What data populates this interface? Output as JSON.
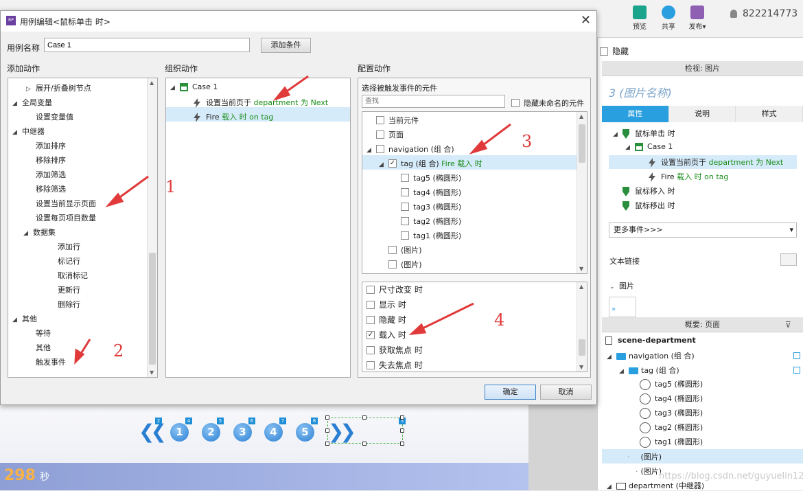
{
  "toolbar": {
    "preview": "预览",
    "share": "共享",
    "publish": "发布▾",
    "user_id": "822214773",
    "colors": {
      "preview": "#1aa48c",
      "share": "#2a9fdf",
      "publish": "#8e5fb3"
    }
  },
  "canvas": {
    "timer": "298",
    "timer_unit": "秒",
    "page_buttons": [
      "1",
      "2",
      "3",
      "4",
      "5"
    ],
    "badges": [
      "2",
      "4",
      "5",
      "6",
      "7",
      "8",
      "3"
    ]
  },
  "right_panel": {
    "hide_label": "隐藏",
    "inspector_header": "检视: 图片",
    "widget_title": "3  (图片名称)",
    "tabs": [
      "属性",
      "说明",
      "样式"
    ],
    "tree": {
      "event1": "鼠标单击 时",
      "case": "Case 1",
      "action1_prefix": "设置当前页于 ",
      "action1_value": "department 为 Next",
      "action2_prefix": "Fire ",
      "action2_value": "载入 时 on tag",
      "event2": "鼠标移入 时",
      "event3": "鼠标移出 时"
    },
    "more_events": "更多事件>>>",
    "text_link": "文本链接",
    "image_section": "图片",
    "overview_header": "概要: 页面",
    "overview": {
      "root": "scene-department",
      "nav": "navigation (组 合)",
      "tag": "tag (组 合)",
      "tags": [
        "tag5 (椭圆形)",
        "tag4 (椭圆形)",
        "tag3 (椭圆形)",
        "tag2 (椭圆形)",
        "tag1 (椭圆形)"
      ],
      "img1": "(图片)",
      "img2": "(图片)",
      "repeater": "department (中继器)"
    },
    "watermark": "https://blog.csdn.net/guyuelin123"
  },
  "dialog": {
    "title": "用例编辑<鼠标单击 时>",
    "case_name_label": "用例名称",
    "case_name_value": "Case 1",
    "add_condition": "添加条件",
    "col_add": "添加动作",
    "col_organize": "组织动作",
    "col_config": "配置动作",
    "add_actions": [
      {
        "label": "展开/折叠树节点",
        "level": 2,
        "toggle": "▷"
      },
      {
        "label": "全局变量",
        "level": 0,
        "toggle": "◢"
      },
      {
        "label": "设置变量值",
        "level": 2,
        "toggle": ""
      },
      {
        "label": "中继器",
        "level": 0,
        "toggle": "◢"
      },
      {
        "label": "添加排序",
        "level": 2,
        "toggle": ""
      },
      {
        "label": "移除排序",
        "level": 2,
        "toggle": ""
      },
      {
        "label": "添加筛选",
        "level": 2,
        "toggle": ""
      },
      {
        "label": "移除筛选",
        "level": 2,
        "toggle": ""
      },
      {
        "label": "设置当前显示页面",
        "level": 2,
        "toggle": ""
      },
      {
        "label": "设置每页项目数量",
        "level": 2,
        "toggle": ""
      },
      {
        "label": "数据集",
        "level": 1,
        "toggle": "◢"
      },
      {
        "label": "添加行",
        "level": 3,
        "toggle": ""
      },
      {
        "label": "标记行",
        "level": 3,
        "toggle": ""
      },
      {
        "label": "取消标记",
        "level": 3,
        "toggle": ""
      },
      {
        "label": "更新行",
        "level": 3,
        "toggle": ""
      },
      {
        "label": "删除行",
        "level": 3,
        "toggle": ""
      },
      {
        "label": "其他",
        "level": 0,
        "toggle": "◢"
      },
      {
        "label": "等待",
        "level": 2,
        "toggle": ""
      },
      {
        "label": "其他",
        "level": 2,
        "toggle": ""
      },
      {
        "label": "触发事件",
        "level": 2,
        "toggle": ""
      }
    ],
    "organize": {
      "case": "Case 1",
      "action1_prefix": "设置当前页于 ",
      "action1_value": "department 为 Next",
      "action2_prefix": "Fire ",
      "action2_value": "载入 时 on tag"
    },
    "config": {
      "select_label": "选择被触发事件的元件",
      "search_placeholder": "查找",
      "hide_unnamed": "隐藏未命名的元件",
      "widgets": [
        {
          "label": "当前元件",
          "indent": 1,
          "checked": false,
          "toggle": ""
        },
        {
          "label": "页面",
          "indent": 1,
          "checked": false,
          "toggle": ""
        },
        {
          "label": "navigation (组 合)",
          "indent": 1,
          "checked": false,
          "toggle": "◢"
        },
        {
          "label": "tag (组 合)",
          "suffix": " Fire 载入 时",
          "indent": 2,
          "checked": true,
          "toggle": "◢"
        },
        {
          "label": "tag5 (椭圆形)",
          "indent": 3,
          "checked": false,
          "toggle": ""
        },
        {
          "label": "tag4 (椭圆形)",
          "indent": 3,
          "checked": false,
          "toggle": ""
        },
        {
          "label": "tag3 (椭圆形)",
          "indent": 3,
          "checked": false,
          "toggle": ""
        },
        {
          "label": "tag2 (椭圆形)",
          "indent": 3,
          "checked": false,
          "toggle": ""
        },
        {
          "label": "tag1 (椭圆形)",
          "indent": 3,
          "checked": false,
          "toggle": ""
        },
        {
          "label": "(图片)",
          "indent": 2,
          "checked": false,
          "toggle": ""
        },
        {
          "label": "(图片)",
          "indent": 2,
          "checked": false,
          "toggle": ""
        }
      ],
      "events": [
        {
          "label": "尺寸改变 时",
          "checked": false
        },
        {
          "label": "显示 时",
          "checked": false
        },
        {
          "label": "隐藏 时",
          "checked": false
        },
        {
          "label": "载入 时",
          "checked": true
        },
        {
          "label": "获取焦点 时",
          "checked": false
        },
        {
          "label": "失去焦点 时",
          "checked": false
        }
      ]
    },
    "ok": "确定",
    "cancel": "取消"
  },
  "annotations": [
    "1",
    "2",
    "3",
    "4"
  ],
  "annotation_color": "#e03a3a"
}
